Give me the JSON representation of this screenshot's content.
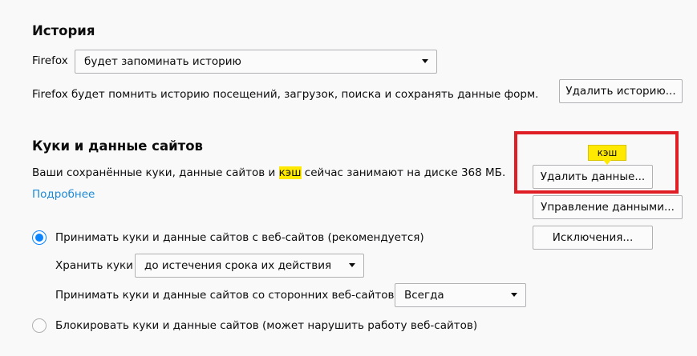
{
  "history": {
    "heading": "История",
    "firefox_label": "Firefox",
    "mode_select": "будет запоминать историю",
    "description": "Firefox будет помнить историю посещений, загрузок, поиска и сохранять данные форм.",
    "clear_history_button": "Удалить историю..."
  },
  "cookies": {
    "heading": "Куки и данные сайтов",
    "description_before": "Ваши сохранённые куки, данные сайтов и ",
    "description_highlight": "кэш",
    "description_after": " сейчас занимают на диске 368 МБ.",
    "learn_more_link": "Подробнее",
    "clear_data_button": "Удалить данные...",
    "manage_data_button": "Управление данными...",
    "exceptions_button": "Исключения...",
    "tooltip": "кэш",
    "accept_radio_label": "Принимать куки и данные сайтов с веб-сайтов (рекомендуется)",
    "keep_label": "Хранить куки",
    "keep_select": "до истечения срока их действия",
    "third_party_label": "Принимать куки и данные сайтов со сторонних веб-сайтов",
    "third_party_select": "Всегда",
    "block_radio_label": "Блокировать куки и данные сайтов (может нарушить работу веб-сайтов)",
    "accept_checked": true
  },
  "colors": {
    "accent": "#0a84ff",
    "highlight": "#ffe900",
    "annotation_red": "#e01e26"
  }
}
